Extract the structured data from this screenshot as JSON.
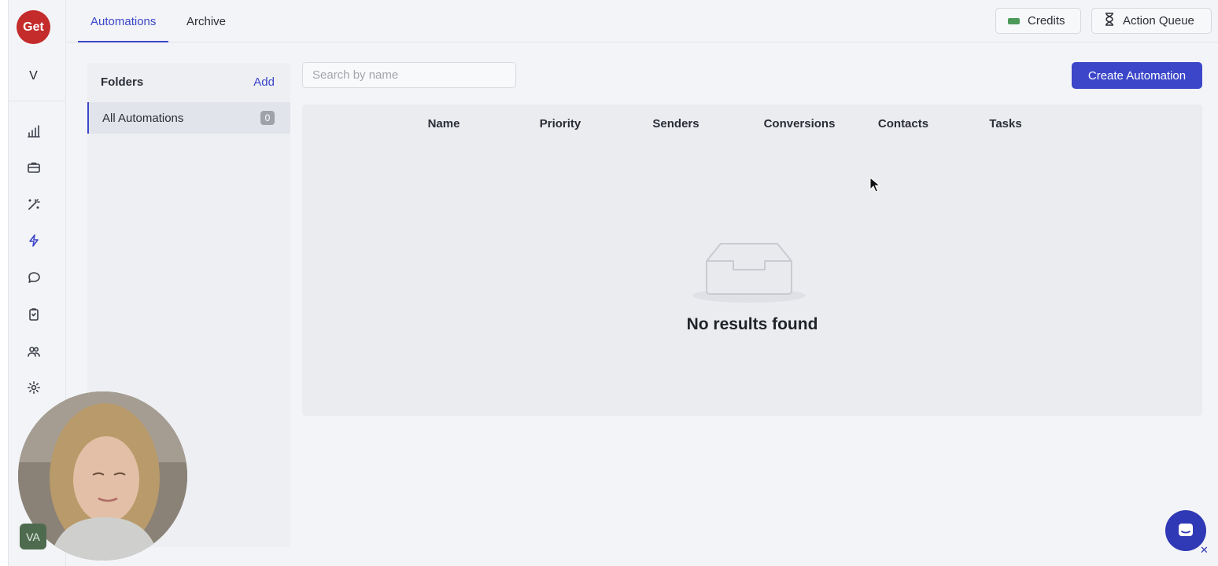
{
  "logo": {
    "text": "Get"
  },
  "user_initial": "V",
  "rail": {
    "items": [
      {
        "name": "analytics",
        "icon": "bar-chart-icon"
      },
      {
        "name": "campaigns",
        "icon": "briefcase-icon"
      },
      {
        "name": "ai-tools",
        "icon": "magic-wand-icon"
      },
      {
        "name": "automations",
        "icon": "lightning-icon",
        "active": true
      },
      {
        "name": "inbox",
        "icon": "chat-bubble-icon"
      },
      {
        "name": "tasks",
        "icon": "clipboard-icon"
      },
      {
        "name": "contacts",
        "icon": "people-icon"
      },
      {
        "name": "settings",
        "icon": "gear-icon"
      }
    ]
  },
  "header": {
    "tabs": [
      {
        "label": "Automations",
        "active": true
      },
      {
        "label": "Archive",
        "active": false
      }
    ],
    "credits_label": "Credits",
    "action_queue_label": "Action Queue"
  },
  "folders": {
    "title": "Folders",
    "add_label": "Add",
    "items": [
      {
        "label": "All Automations",
        "count": "0"
      }
    ]
  },
  "search": {
    "placeholder": "Search by name"
  },
  "create_button": {
    "label": "Create Automation"
  },
  "table": {
    "columns": [
      "Name",
      "Priority",
      "Senders",
      "Conversions",
      "Contacts",
      "Tasks"
    ],
    "empty_message": "No results found"
  },
  "overlay": {
    "avatar_initials": "VA"
  },
  "colors": {
    "accent": "#3b46c9",
    "logo": "#c42b2b",
    "credits": "#4c9a5a"
  }
}
